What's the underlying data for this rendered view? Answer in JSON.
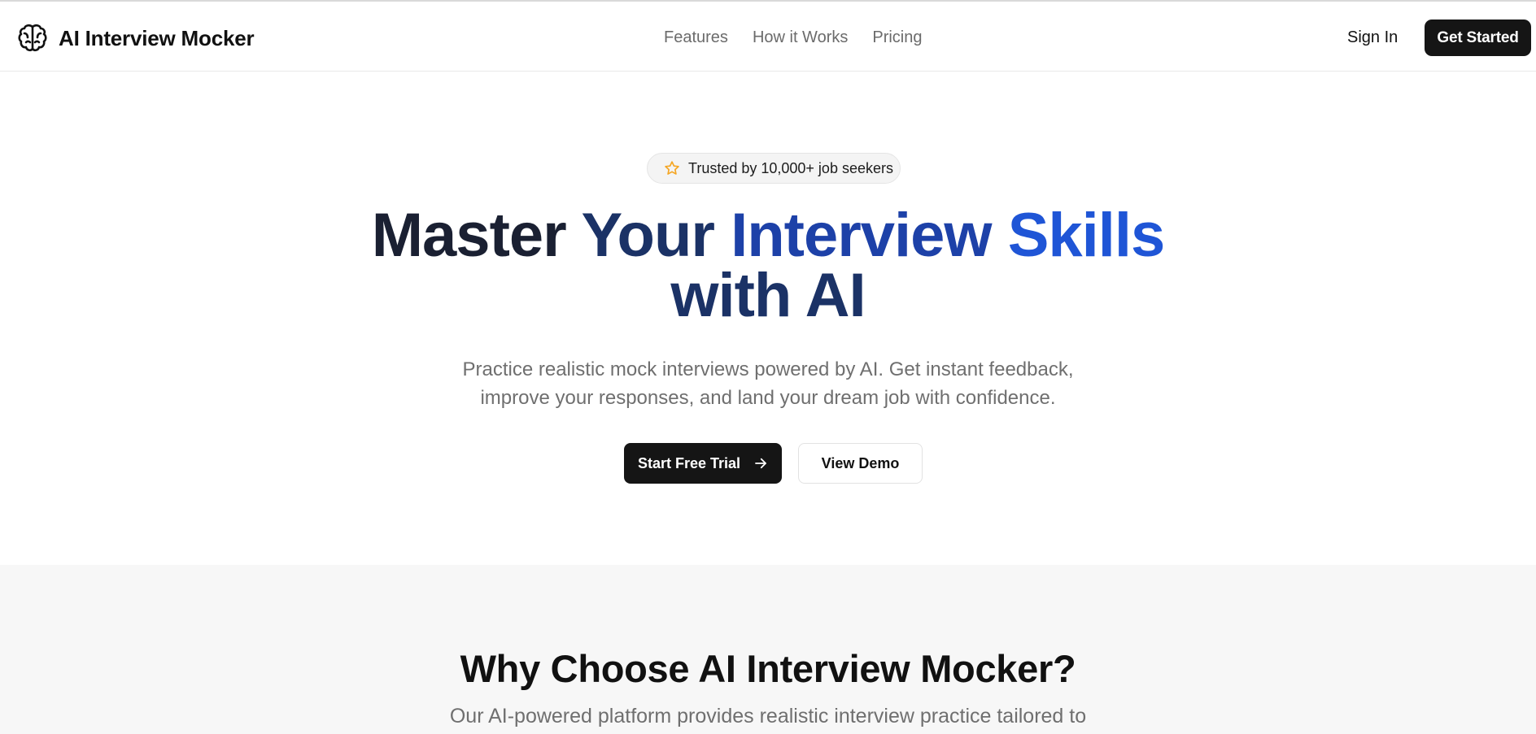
{
  "header": {
    "brand_name": "AI Interview Mocker",
    "brand_icon": "brain-icon",
    "nav": [
      {
        "label": "Features"
      },
      {
        "label": "How it Works"
      },
      {
        "label": "Pricing"
      }
    ],
    "sign_in_label": "Sign In",
    "get_started_label": "Get Started"
  },
  "hero": {
    "badge_icon": "star-icon",
    "badge_text": "Trusted by 10,000+ job seekers",
    "title_parts": [
      "Master",
      "Your",
      "Interview",
      "Skills",
      "with AI"
    ],
    "subtitle_lines": [
      "Practice realistic mock interviews powered by AI. Get instant feedback,",
      "improve your responses, and land your dream job with confidence."
    ],
    "primary_cta": "Start Free Trial",
    "primary_cta_icon": "arrow-right-icon",
    "secondary_cta": "View Demo"
  },
  "features": {
    "title": "Why Choose AI Interview Mocker?",
    "subtitle": "Our AI-powered platform provides realistic interview practice tailored to"
  },
  "colors": {
    "primary_button": "#151515",
    "accent_blue": "#1f55d6",
    "badge_star": "#f5a623",
    "section_bg": "#f7f7f7"
  }
}
